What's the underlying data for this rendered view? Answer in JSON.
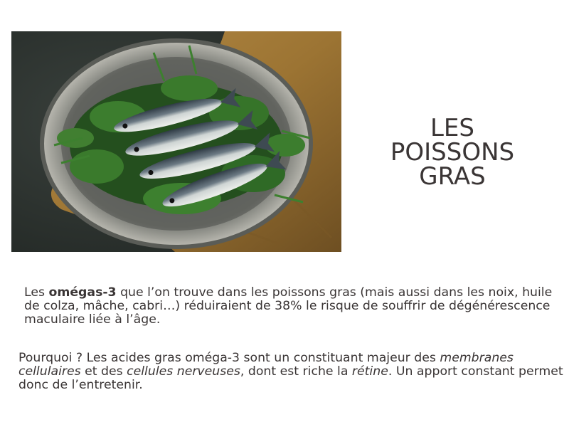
{
  "title": {
    "line1": "LES",
    "line2": "POISSONS",
    "line3": "GRAS"
  },
  "paragraph1": {
    "part1": "Les ",
    "bold": "omégas-3",
    "part2": " que l’on trouve dans les poissons gras (mais aussi dans les noix, huile de colza, mâche, cabri…) réduiraient de 38% le risque de souffrir de dégénérescence maculaire liée à l’âge."
  },
  "paragraph2": {
    "part1": "Pourquoi ? Les acides gras oméga-3 sont un constituant majeur des ",
    "italic1": "membranes cellulaires",
    "part2": " et des ",
    "italic2": "cellules nerveuses",
    "part3": ", dont est riche la ",
    "italic3": "rétine",
    "part4": ". Un apport constant permet donc de l’entretenir."
  },
  "image": {
    "subject": "sardines-on-parsley-platter",
    "colors": {
      "background": "#2a302d",
      "cloth": "#a07a3e",
      "platter": "#9a9a94",
      "parsley": "#2f6a26",
      "fish_back": "#3e4a52",
      "fish_belly": "#d8dcd8"
    }
  }
}
